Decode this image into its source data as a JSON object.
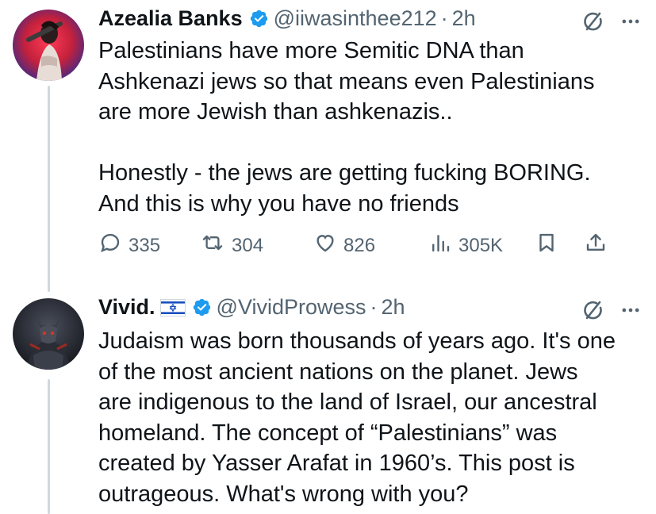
{
  "tweets": [
    {
      "name": "Azealia Banks",
      "handle": "@iiwasinthee212",
      "separator": "·",
      "time": "2h",
      "text": "Palestinians have more Semitic DNA than\nAshkenazi jews so that means even Palestinians\nare more Jewish than ashkenazis..\n\nHonestly - the jews are getting fucking BORING.\nAnd this is why you have no friends",
      "replies": "335",
      "retweets": "304",
      "likes": "826",
      "views": "305K"
    },
    {
      "name": "Vivid.",
      "handle": "@VividProwess",
      "separator": "·",
      "time": "2h",
      "text": "Judaism was born thousands of years ago. It's one\nof the most ancient nations on the planet. Jews\nare indigenous to the land of Israel, our ancestral\nhomeland. The concept of “Palestinians” was\ncreated by Yasser Arafat in 1960’s. This post is\noutrageous. What's wrong with you?"
    }
  ],
  "colors": {
    "verified": "#1d9bf0",
    "secondary_text": "#536471",
    "thread_line": "#cfd9de"
  },
  "icons": [
    "verified-badge-icon",
    "grok-icon",
    "more-icon",
    "reply-icon",
    "retweet-icon",
    "like-icon",
    "views-icon",
    "bookmark-icon",
    "share-icon",
    "israel-flag-icon"
  ]
}
